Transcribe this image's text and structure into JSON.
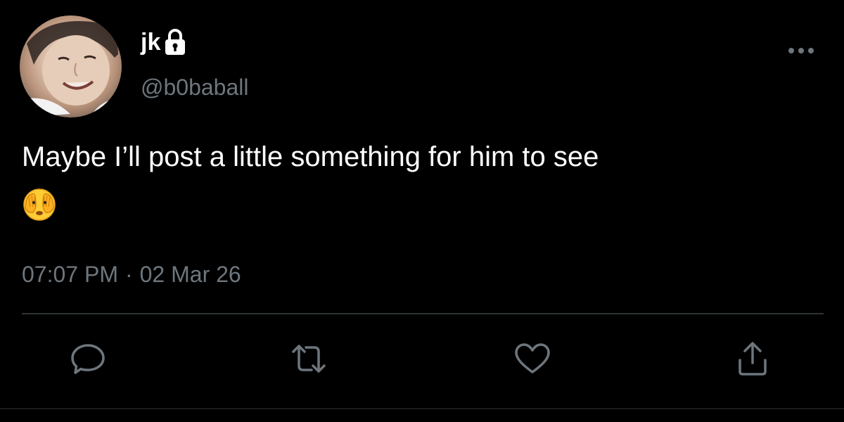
{
  "tweet": {
    "author": {
      "display_name": "jk",
      "handle": "@b0baball",
      "protected": true,
      "avatar_icon": "profile-photo"
    },
    "text": "Maybe I’ll post a little something for him to see",
    "emoji_icon": "face-with-hands-over-eyes-emoji",
    "timestamp": {
      "time": "07:07 PM",
      "separator": "·",
      "date": "02 Mar 26"
    },
    "actions": [
      {
        "icon": "reply-icon"
      },
      {
        "icon": "retweet-icon"
      },
      {
        "icon": "like-icon"
      },
      {
        "icon": "share-icon"
      }
    ],
    "menu_icon": "more-options-icon"
  },
  "colors": {
    "background": "#000000",
    "primary_text": "#ffffff",
    "secondary_text": "#6e767d",
    "divider": "#2f3336"
  }
}
